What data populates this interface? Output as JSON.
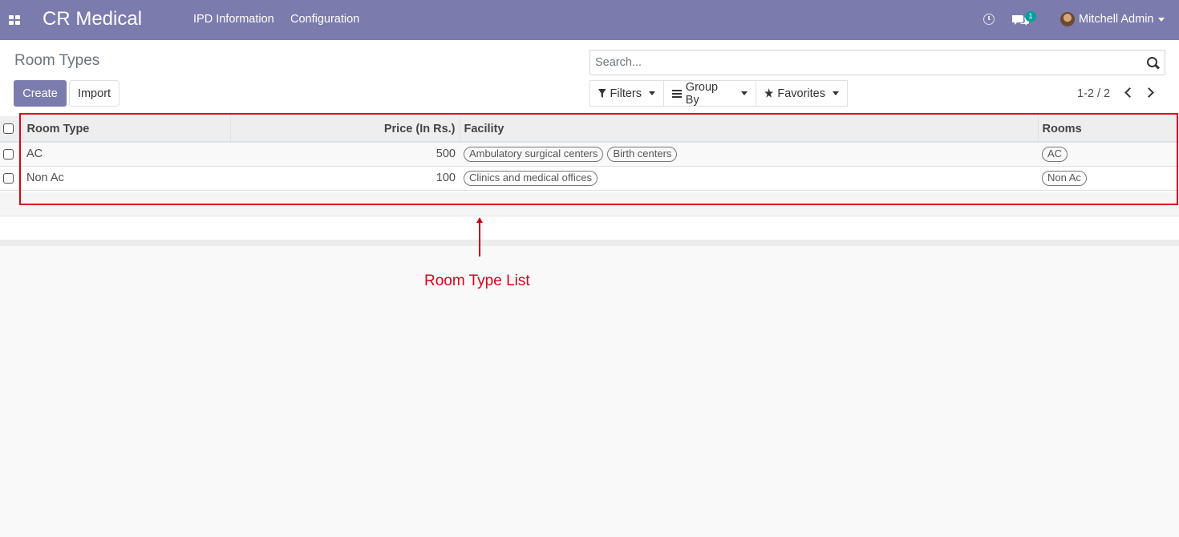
{
  "navbar": {
    "brand": "CR Medical",
    "menu": [
      "IPD Information",
      "Configuration"
    ],
    "chat_badge": "1",
    "user_name": "Mitchell Admin",
    "icons": [
      "apps-grid-icon",
      "clock-icon",
      "chat-icon",
      "avatar"
    ]
  },
  "control_panel": {
    "title": "Room Types",
    "create_label": "Create",
    "import_label": "Import",
    "search_placeholder": "Search...",
    "filters_label": "Filters",
    "group_by_label": "Group By",
    "favorites_label": "Favorites",
    "pager_value": "1-2 / 2"
  },
  "list": {
    "columns": {
      "room_type": "Room Type",
      "price": "Price (In Rs.)",
      "facility": "Facility",
      "rooms": "Rooms"
    },
    "rows": [
      {
        "room_type": "AC",
        "price": "500",
        "facilities": [
          "Ambulatory surgical centers",
          "Birth centers"
        ],
        "rooms": [
          "AC"
        ]
      },
      {
        "room_type": "Non Ac",
        "price": "100",
        "facilities": [
          "Clinics and medical offices"
        ],
        "rooms": [
          "Non Ac"
        ]
      }
    ]
  },
  "annotation": {
    "label": "Room Type List",
    "color": "#d9001b"
  },
  "colors": {
    "brand_purple": "#7c7bad",
    "badge_teal": "#00a09d"
  }
}
